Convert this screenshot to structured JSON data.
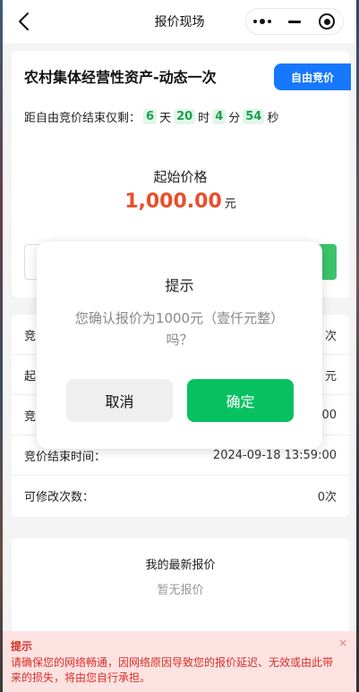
{
  "nav": {
    "title": "报价现场"
  },
  "item": {
    "title": "农村集体经营性资产-动态一次",
    "tag": "自由竞价"
  },
  "countdown": {
    "prefix": "距自由竞价结束仅剩：",
    "days": "6",
    "days_unit": "天",
    "hours": "20",
    "hours_unit": "时",
    "minutes": "4",
    "minutes_unit": "分",
    "seconds": "54",
    "seconds_unit": "秒"
  },
  "start_price": {
    "label": "起始价格",
    "value": "1,000.00",
    "unit": "元"
  },
  "info_rows": [
    {
      "label": "竞",
      "value": "次"
    },
    {
      "label": "起",
      "value": "元"
    },
    {
      "label": "竞",
      "value": "00"
    },
    {
      "label": "竞价结束时间：",
      "value": "2024-09-18 13:59:00"
    },
    {
      "label": "可修改次数：",
      "value": "0次"
    }
  ],
  "latest_bid": {
    "title": "我的最新报价",
    "empty_text": "暂无报价"
  },
  "warning": {
    "title": "提示",
    "text": "请确保您的网络畅通，因网络原因导致您的报价延迟、无效或由此带来的损失，将由您自行承担。",
    "close": "×"
  },
  "modal": {
    "title": "提示",
    "message": "您确认报价为1000元（壹仟元整）吗？",
    "cancel_label": "取消",
    "confirm_label": "确定"
  },
  "colors": {
    "accent_blue": "#1677ff",
    "price_red": "#e84e2a",
    "confirm_green": "#07c160",
    "countdown_green": "#17a34a",
    "warning_red": "#d93025"
  }
}
